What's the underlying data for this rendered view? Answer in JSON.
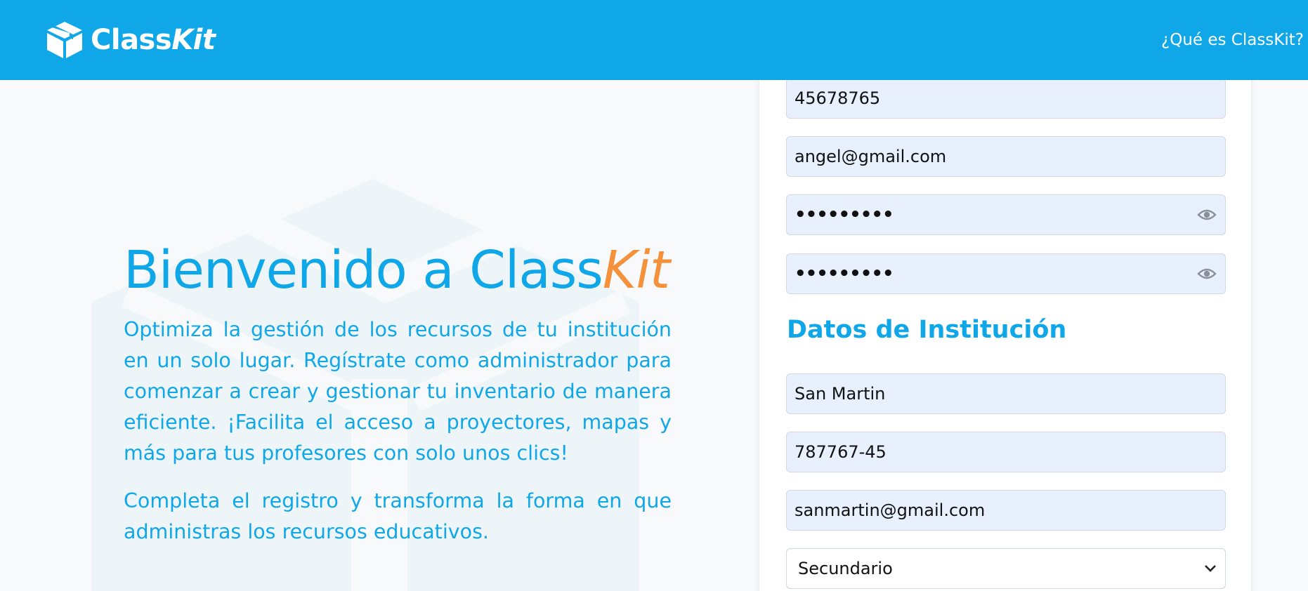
{
  "header": {
    "brand_class": "Class",
    "brand_kit": "Kit",
    "nav_link": "¿Qué es ClassKit?"
  },
  "hero": {
    "title_prefix": "Bienvenido a Class",
    "title_kit": "Kit",
    "paragraph_1": "Optimiza la gestión de los recursos de tu institución en un solo lugar. Regístrate como administrador para comenzar a crear y gestionar tu inventario de manera eficiente. ¡Facilita el acceso a proyectores, mapas y más para tus profesores con solo unos clics!",
    "paragraph_2": "Completa el registro y transforma la forma en que administras los recursos educativos."
  },
  "form": {
    "phone_value": "45678765",
    "email_value": "angel@gmail.com",
    "password_value": "•••••••••",
    "confirm_password_value": "•••••••••",
    "institution_section_title": "Datos de Institución",
    "institution_name_value": "San Martin",
    "institution_code_value": "787767-45",
    "institution_email_value": "sanmartin@gmail.com",
    "level_selected": "Secundario"
  },
  "colors": {
    "primary": "#10a7e8",
    "accent": "#f4913a",
    "field_bg": "#e8f0fe"
  },
  "icons": {
    "brand": "box-icon",
    "password_toggle": "eye-icon",
    "select": "chevron-down-icon"
  }
}
